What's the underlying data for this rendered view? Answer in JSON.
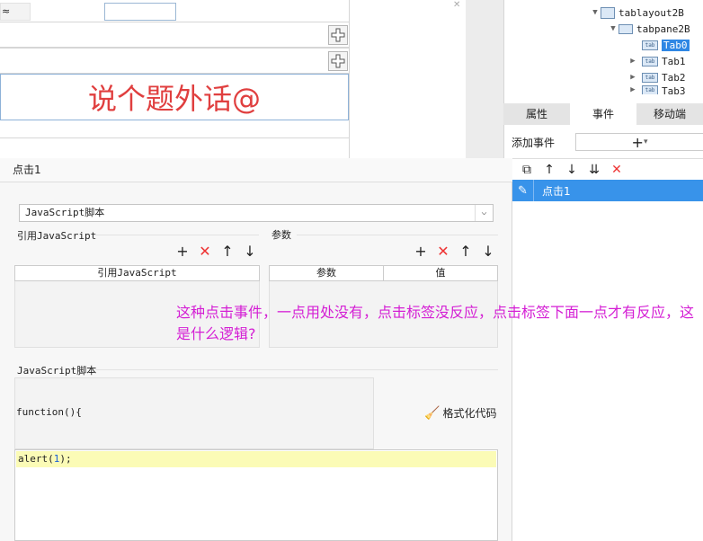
{
  "canvas": {
    "cell_text": "≈",
    "big_label": "说个题外话@"
  },
  "tree": {
    "items": [
      {
        "label": "tablayout2B"
      },
      {
        "label": "tabpane2B"
      },
      {
        "label": "Tab0"
      },
      {
        "label": "Tab1"
      },
      {
        "label": "Tab2"
      },
      {
        "label": "Tab3"
      }
    ]
  },
  "prop_tabs": [
    "属性",
    "事件",
    "移动端"
  ],
  "add_event_label": "添加事件",
  "event_item": "点击1",
  "dialog": {
    "title": "点击1",
    "type_value": "JavaScript脚本",
    "ref_js_label": "引用JavaScript",
    "params_label": "参数",
    "ref_js_col": "引用JavaScript",
    "param_col": "参数",
    "value_col": "值",
    "script_label": "JavaScript脚本",
    "function_text": "function(){",
    "format_label": "格式化代码",
    "code_prefix": "alert(",
    "code_num": "1",
    "code_suffix": ");"
  },
  "annotation": "这种点击事件，一点用处没有，点击标签没反应，点击标签下面一点才有反应，这是什么逻辑?"
}
